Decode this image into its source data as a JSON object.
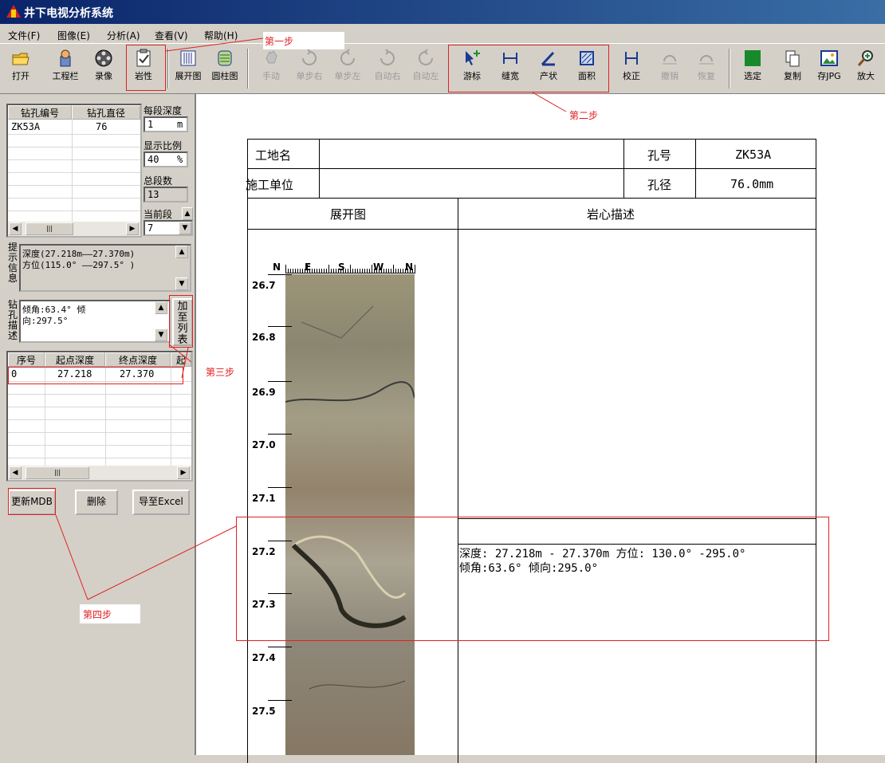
{
  "app": {
    "title": "井下电视分析系统"
  },
  "menu": [
    "文件(F)",
    "图像(E)",
    "分析(A)",
    "查看(V)",
    "帮助(H)"
  ],
  "toolbar": {
    "open": "打开",
    "project_bar": "工程栏",
    "record": "录像",
    "lithology": "岩性",
    "unfold_view": "展开图",
    "cylinder_view": "圆柱图",
    "manual": "手动",
    "step_right": "单步右",
    "step_left": "单步左",
    "auto_right": "自动右",
    "auto_left": "自动左",
    "cursor": "游标",
    "crack_width": "缝宽",
    "attitude": "产状",
    "area": "面积",
    "calibrate": "校正",
    "undo": "撤销",
    "redo": "恢复",
    "select": "选定",
    "copy": "复制",
    "save_jpg": "存JPG",
    "zoom_in": "放大"
  },
  "hole_table": {
    "headers": [
      "钻孔编号",
      "钻孔直径"
    ],
    "rows": [
      {
        "id": "ZK53A",
        "diameter": "76"
      }
    ]
  },
  "segment": {
    "depth_label": "每段深度",
    "depth_value": "1",
    "depth_unit": "m",
    "scale_label": "显示比例",
    "scale_value": "40",
    "scale_unit": "%",
    "total_label": "总段数",
    "total_value": "13",
    "current_label": "当前段",
    "current_value": "7"
  },
  "hint": {
    "label": "提示信息",
    "line1": "深度(27.218m——27.370m)",
    "line2": "方位(115.0° ——297.5° )"
  },
  "borehole_desc": {
    "label": "钻孔描述",
    "line1": "倾角:63.4°  倾",
    "line2": "向:297.5°",
    "add_button": "加至列表"
  },
  "segments_table": {
    "headers": [
      "序号",
      "起点深度",
      "终点深度",
      "起"
    ],
    "rows": [
      {
        "index": "0",
        "start": "27.218",
        "end": "27.370"
      }
    ]
  },
  "buttons": {
    "update_mdb": "更新MDB",
    "delete": "删除",
    "export_excel": "导至Excel"
  },
  "report": {
    "site_label": "工地名",
    "site_value": "",
    "hole_label": "孔号",
    "hole_value": "ZK53A",
    "unit_label": "施工单位",
    "unit_value": "",
    "dia_label": "孔径",
    "dia_value": "76.0mm",
    "col1": "展开图",
    "col2": "岩心描述",
    "compass": [
      "N",
      "E",
      "S",
      "W",
      "N"
    ],
    "depths": [
      "26.7",
      "26.8",
      "26.9",
      "27.0",
      "27.1",
      "27.2",
      "27.3",
      "27.4",
      "27.5"
    ],
    "desc_line1": "深度: 27.218m - 27.370m 方位: 130.0° -295.0°",
    "desc_line2": "倾角:63.6°  倾向:295.0°"
  },
  "annotations": {
    "step1": "第一步",
    "step2": "第二步",
    "step3": "第三步",
    "step4": "第四步"
  }
}
